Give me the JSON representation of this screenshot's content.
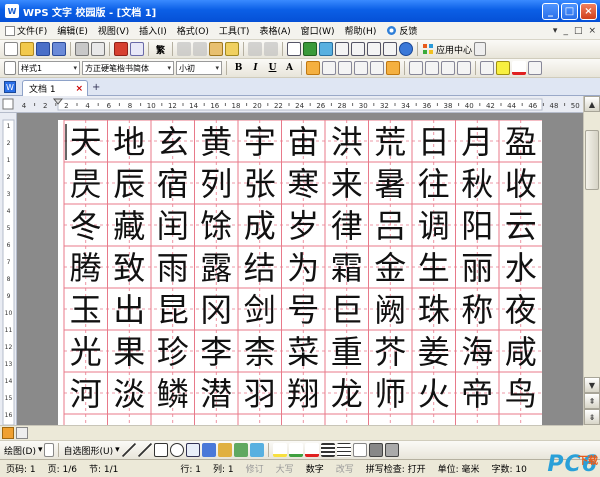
{
  "window": {
    "title": "WPS 文字 校园版 - [文档 1]",
    "app_icon": "W"
  },
  "menu": {
    "items": [
      "文件(F)",
      "编辑(E)",
      "视图(V)",
      "插入(I)",
      "格式(O)",
      "工具(T)",
      "表格(A)",
      "窗口(W)",
      "帮助(H)"
    ],
    "feedback": "反馈",
    "right_controls": [
      "▾",
      "_",
      "□",
      "×"
    ]
  },
  "toolbar1": {
    "traditional": "繁",
    "app_center": "应用中心"
  },
  "toolbar2": {
    "style": "样式1",
    "font": "方正硬笔楷书简体",
    "size": "小初",
    "bold": "B",
    "italic": "I",
    "underline": "U",
    "char_scale": "A"
  },
  "tabs": {
    "doc_tab": "文档 1",
    "close": "×",
    "add": "+"
  },
  "ruler": {
    "h_labels": [
      "4",
      "2",
      "2",
      "4",
      "6",
      "8",
      "10",
      "12",
      "14",
      "16",
      "18",
      "20",
      "22",
      "24",
      "26",
      "28",
      "30",
      "32",
      "34",
      "36",
      "38",
      "40",
      "42",
      "44",
      "46",
      "48",
      "50"
    ],
    "v_labels": [
      "1",
      "2",
      "1",
      "2",
      "3",
      "4",
      "5",
      "6",
      "7",
      "8",
      "9",
      "10",
      "11",
      "12",
      "13",
      "14",
      "15",
      "16"
    ]
  },
  "document": {
    "grid_color": "#e87a8a",
    "rows": [
      [
        "天",
        "地",
        "玄",
        "黄",
        "宇",
        "宙",
        "洪",
        "荒",
        "日",
        "月",
        "盈"
      ],
      [
        "昃",
        "辰",
        "宿",
        "列",
        "张",
        "寒",
        "来",
        "暑",
        "往",
        "秋",
        "收"
      ],
      [
        "冬",
        "藏",
        "闰",
        "馀",
        "成",
        "岁",
        "律",
        "吕",
        "调",
        "阳",
        "云"
      ],
      [
        "腾",
        "致",
        "雨",
        "露",
        "结",
        "为",
        "霜",
        "金",
        "生",
        "丽",
        "水"
      ],
      [
        "玉",
        "出",
        "昆",
        "冈",
        "剑",
        "号",
        "巨",
        "阙",
        "珠",
        "称",
        "夜"
      ],
      [
        "光",
        "果",
        "珍",
        "李",
        "柰",
        "菜",
        "重",
        "芥",
        "姜",
        "海",
        "咸"
      ],
      [
        "河",
        "淡",
        "鳞",
        "潜",
        "羽",
        "翔",
        "龙",
        "师",
        "火",
        "帝",
        "鸟"
      ]
    ]
  },
  "drawbar": {
    "draw": "绘图(D)",
    "autoshape": "自选图形(U)"
  },
  "status": {
    "page": "页码: 1",
    "pages": "页: 1/6",
    "section": "节: 1/1",
    "row": "行: 1",
    "col": "列: 1",
    "revise": "修订",
    "caps": "大写",
    "num": "数字",
    "overwrite": "改写",
    "spellcheck": "拼写检查: 打开",
    "unit": "单位: 毫米",
    "words": "字数: 10"
  },
  "logo": {
    "text": "PC6",
    "sub": "下载"
  }
}
